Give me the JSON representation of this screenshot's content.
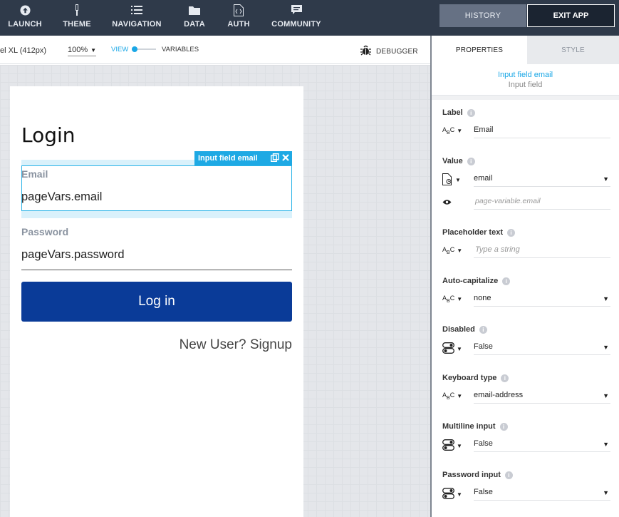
{
  "nav": [
    {
      "id": "launch",
      "label": "LAUNCH",
      "icon": "launch-icon"
    },
    {
      "id": "theme",
      "label": "THEME",
      "icon": "brush-icon"
    },
    {
      "id": "navigation",
      "label": "NAVIGATION",
      "icon": "list-icon"
    },
    {
      "id": "data",
      "label": "DATA",
      "icon": "folder-icon"
    },
    {
      "id": "auth",
      "label": "AUTH",
      "icon": "file-code-icon"
    },
    {
      "id": "community",
      "label": "COMMUNITY",
      "icon": "chat-icon"
    }
  ],
  "header": {
    "history": "HISTORY",
    "exit": "EXIT APP"
  },
  "toolbar": {
    "device": "el XL (412px)",
    "zoom": "100%",
    "view": "VIEW",
    "variables": "VARIABLES",
    "debugger": "DEBUGGER"
  },
  "canvas": {
    "title": "Login",
    "selection_tag": "Input field email",
    "email_label": "Email",
    "email_value": "pageVars.email",
    "password_label": "Password",
    "password_value": "pageVars.password",
    "login_button": "Log in",
    "signup_link": "New User? Signup"
  },
  "panel": {
    "tabs": {
      "properties": "PROPERTIES",
      "style": "STYLE"
    },
    "component_name": "Input field email",
    "component_type": "Input field",
    "props": [
      {
        "title": "Label",
        "value": "Email"
      },
      {
        "title": "Value",
        "value": "email",
        "sub_value": "page-variable.email"
      },
      {
        "title": "Placeholder text",
        "value": "Type a string"
      },
      {
        "title": "Auto-capitalize",
        "value": "none"
      },
      {
        "title": "Disabled",
        "value": "False"
      },
      {
        "title": "Keyboard type",
        "value": "email-address"
      },
      {
        "title": "Multiline input",
        "value": "False"
      },
      {
        "title": "Password input",
        "value": "False"
      }
    ]
  },
  "colors": {
    "accent": "#1aa7e6",
    "primary_button": "#0a3b98",
    "topbar": "#2f3a4a"
  }
}
